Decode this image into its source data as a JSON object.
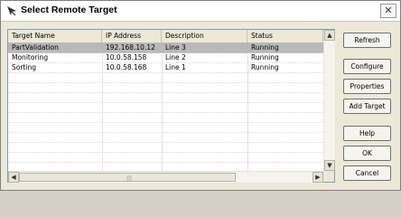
{
  "window": {
    "title": "Select Remote Target",
    "close_label": "✕"
  },
  "table": {
    "columns": [
      "Target Name",
      "IP Address",
      "Description",
      "Status"
    ],
    "rows": [
      {
        "name": "PartValidation",
        "ip": "192.168.10.12",
        "description": "Line 3",
        "status": "Running",
        "selected": true
      },
      {
        "name": "Monitoring",
        "ip": "10.0.58.158",
        "description": "Line 2",
        "status": "Running",
        "selected": false
      },
      {
        "name": "Sorting",
        "ip": "10.0.58.168",
        "description": "Line 1",
        "status": "Running",
        "selected": false
      }
    ]
  },
  "scroll": {
    "up": "▲",
    "down": "▼",
    "left": "◀",
    "right": "▶",
    "grip": "|||"
  },
  "buttons": {
    "refresh": "Refresh",
    "configure": "Configure",
    "properties": "Properties",
    "add_target": "Add Target",
    "help": "Help",
    "ok": "OK",
    "cancel": "Cancel"
  },
  "colors": {
    "selected_row": "#b9b9b9",
    "dialog_bg": "#ece9d8"
  }
}
